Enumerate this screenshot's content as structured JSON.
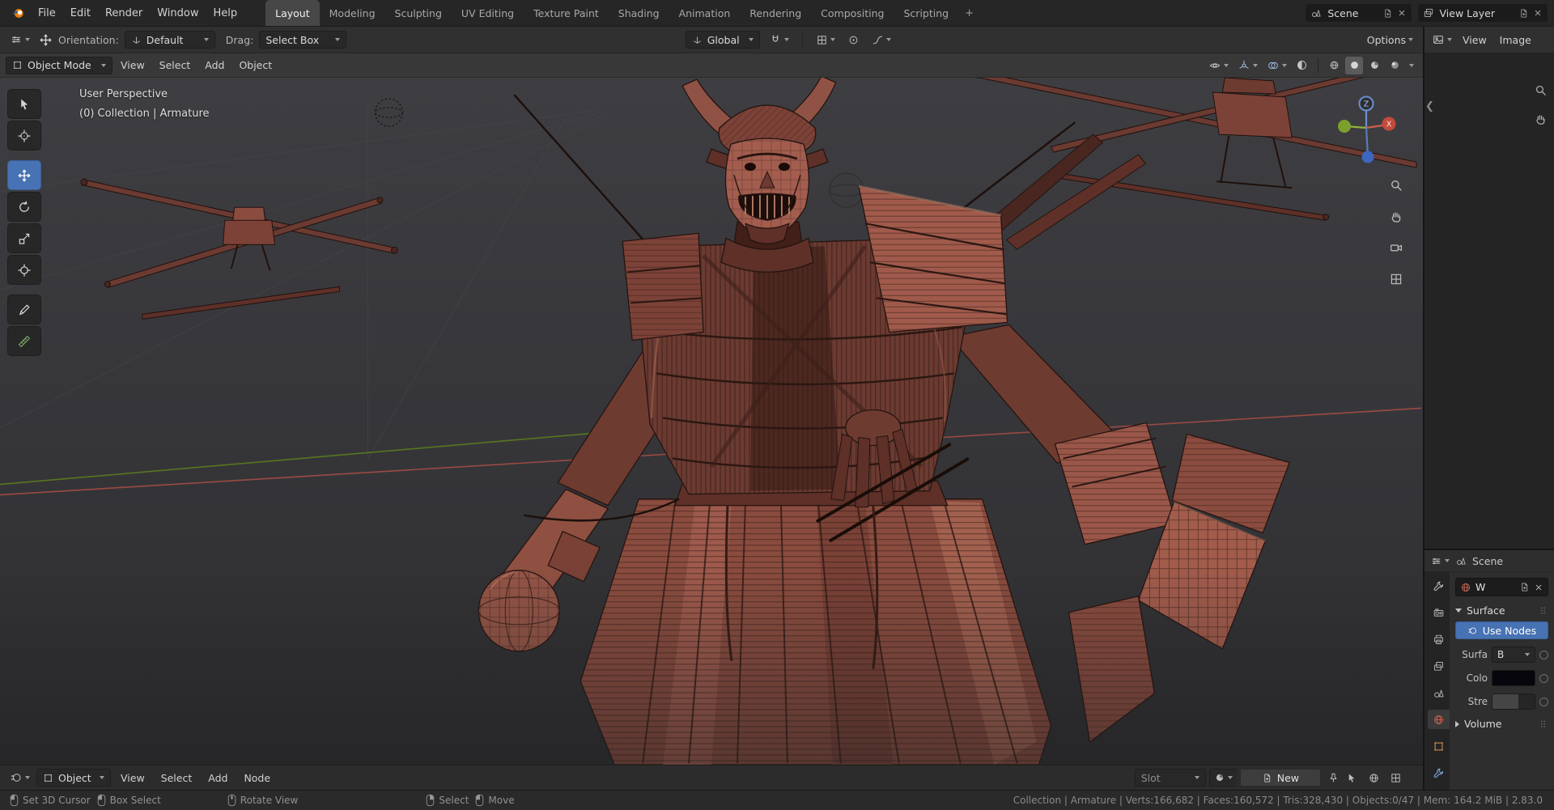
{
  "colors": {
    "accent": "#4772b3",
    "clay_base": "#9a564a",
    "active_tool": "#4772b3",
    "axis_x": "#9c4a43",
    "axis_y": "#55771f",
    "gizmo_x": "#c44a3e",
    "gizmo_y": "#7ba02c",
    "gizmo_z": "#3c66c0",
    "world_tab": "#d4604e",
    "object_tab": "#dd9552",
    "modifier_tab": "#7fa8dd"
  },
  "topbar": {
    "menus": [
      "File",
      "Edit",
      "Render",
      "Window",
      "Help"
    ],
    "tabs": [
      "Layout",
      "Modeling",
      "Sculpting",
      "UV Editing",
      "Texture Paint",
      "Shading",
      "Animation",
      "Rendering",
      "Compositing",
      "Scripting"
    ],
    "active_tab": "Layout",
    "add_tab_label": "+",
    "scene": {
      "label": "Scene"
    },
    "view_layer": {
      "label": "View Layer"
    }
  },
  "tool_settings": {
    "orientation_label": "Orientation:",
    "orientation_value": "Default",
    "drag_label": "Drag:",
    "drag_value": "Select Box",
    "pivot_value": "Global",
    "options_label": "Options"
  },
  "viewport": {
    "mode": "Object Mode",
    "menus": [
      "View",
      "Select",
      "Add",
      "Object"
    ],
    "overlay": {
      "line1": "User Perspective",
      "line2": "(0) Collection | Armature"
    },
    "gizmo": {
      "z": "Z",
      "x": "X"
    }
  },
  "image_editor": {
    "menus": [
      "View",
      "Image"
    ]
  },
  "properties": {
    "breadcrumb": "Scene",
    "world": {
      "name": "W"
    },
    "surface_section": "Surface",
    "use_nodes": "Use Nodes",
    "rows": [
      {
        "label": "Surfa",
        "value": "B"
      },
      {
        "label": "Colo",
        "value": ""
      },
      {
        "label": "Stre",
        "value": ""
      }
    ],
    "volume_section": "Volume"
  },
  "shader_editor": {
    "type_value": "Object",
    "menus": [
      "View",
      "Select",
      "Add",
      "Node"
    ],
    "slot_label": "Slot",
    "new_label": "New"
  },
  "statusbar": {
    "hints": [
      {
        "button": "left",
        "label": "Set 3D Cursor"
      },
      {
        "button": "left",
        "label": "Box Select"
      },
      {
        "button": "middle",
        "label": "Rotate View"
      },
      {
        "button": "right",
        "label": "Select"
      },
      {
        "button": "left",
        "label": "Move"
      }
    ],
    "stats": "Collection | Armature | Verts:166,682 | Faces:160,572 | Tris:328,430 | Objects:0/47 | Mem: 164.2 MiB | 2.83.0"
  }
}
